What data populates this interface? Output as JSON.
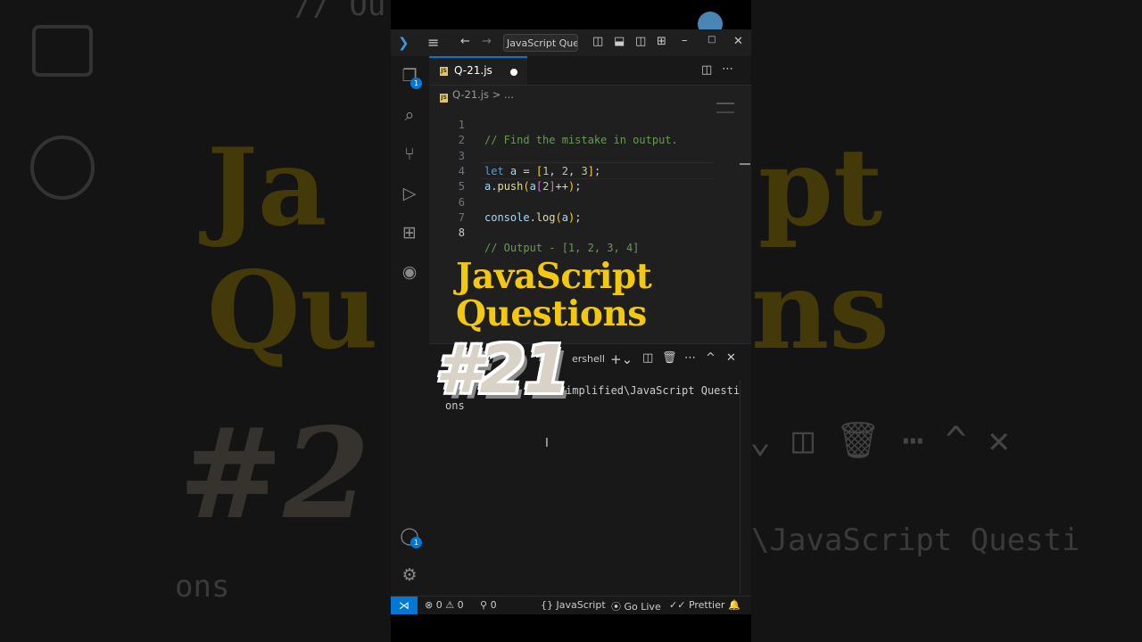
{
  "window": {
    "search_label": "JavaScript Quest"
  },
  "tab": {
    "filename": "Q-21.js",
    "js_badge": "JS"
  },
  "breadcrumb": {
    "file": "Q-21.js",
    "sep": ">",
    "more": "..."
  },
  "code_lines": [
    {
      "n": "1",
      "text": "// Find the mistake in output."
    },
    {
      "n": "2",
      "text": ""
    },
    {
      "n": "3",
      "text": "let a = [1, 2, 3];"
    },
    {
      "n": "4",
      "text": "a.push(a[2]++);"
    },
    {
      "n": "5",
      "text": ""
    },
    {
      "n": "6",
      "text": "console.log(a);"
    },
    {
      "n": "7",
      "text": ""
    },
    {
      "n": "8",
      "text": "// Output - [1, 2, 3, 4]"
    }
  ],
  "panel": {
    "shell_label": "ershell",
    "term_line1": "implified\\JavaScript Questi",
    "term_line2": "ons"
  },
  "activity_badges": {
    "explorer": "1",
    "accounts": "1"
  },
  "statusbar": {
    "errors": "0",
    "warnings": "0",
    "ports": "0",
    "language": "JavaScript",
    "go_live": "Go Live",
    "prettier": "Prettier"
  },
  "overlay": {
    "line1": "JavaScript",
    "line2": "Questions",
    "number": "#21"
  },
  "background": {
    "word1": "Ja",
    "word2": "pt",
    "word3": "Qu",
    "word4": "ns",
    "code_text": "\\JavaScript Questi",
    "code_text2": "ons",
    "code_top": "// Ou"
  },
  "colors": {
    "accent": "#0078d4",
    "title_yellow": "#f2c811",
    "comment_green": "#6a9955"
  }
}
